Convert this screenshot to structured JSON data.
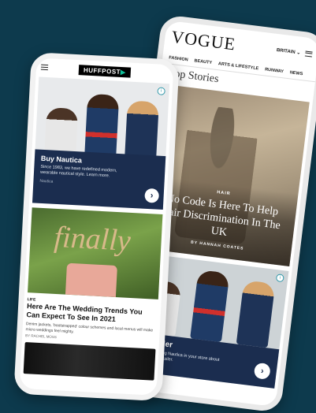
{
  "vogue": {
    "logo": "VOGUE",
    "region": "BRITAIN ⌄",
    "nav": [
      "FASHION",
      "BEAUTY",
      "ARTS & LIFESTYLE",
      "RUNWAY",
      "NEWS"
    ],
    "section_title": "Top Stories",
    "hero": {
      "kicker": "HAIR",
      "headline": "No Code Is Here To Help Hair Discrimination In The UK",
      "byline": "BY HANNAH COATES"
    },
    "ad": {
      "title": "a Retailer",
      "body": "Are you missing Nautica in your store about becoming a retailer.",
      "arrow": "›"
    }
  },
  "huffpost": {
    "logo_main": "HUFFPOST",
    "logo_dot": "▶",
    "ad": {
      "title": "Buy Nautica",
      "body": "Since 1983, we have redefined modern, wearable nautical style. Learn more.",
      "sponsor": "Nautica",
      "info": "i",
      "arrow": "›"
    },
    "article": {
      "image_text": "finally",
      "kicker": "LIFE",
      "headline": "Here Are The Wedding Trends You Can Expect To See In 2021",
      "snippet": "Denim jackets, 'bootstrapped' colour schemes and local menus will make micro weddings feel mighty.",
      "byline": "BY RACHEL MOSS"
    }
  },
  "colors": {
    "background": "#0d3a4d",
    "ad_navy": "#1b2d4f",
    "huff_accent": "#0dbe98"
  }
}
